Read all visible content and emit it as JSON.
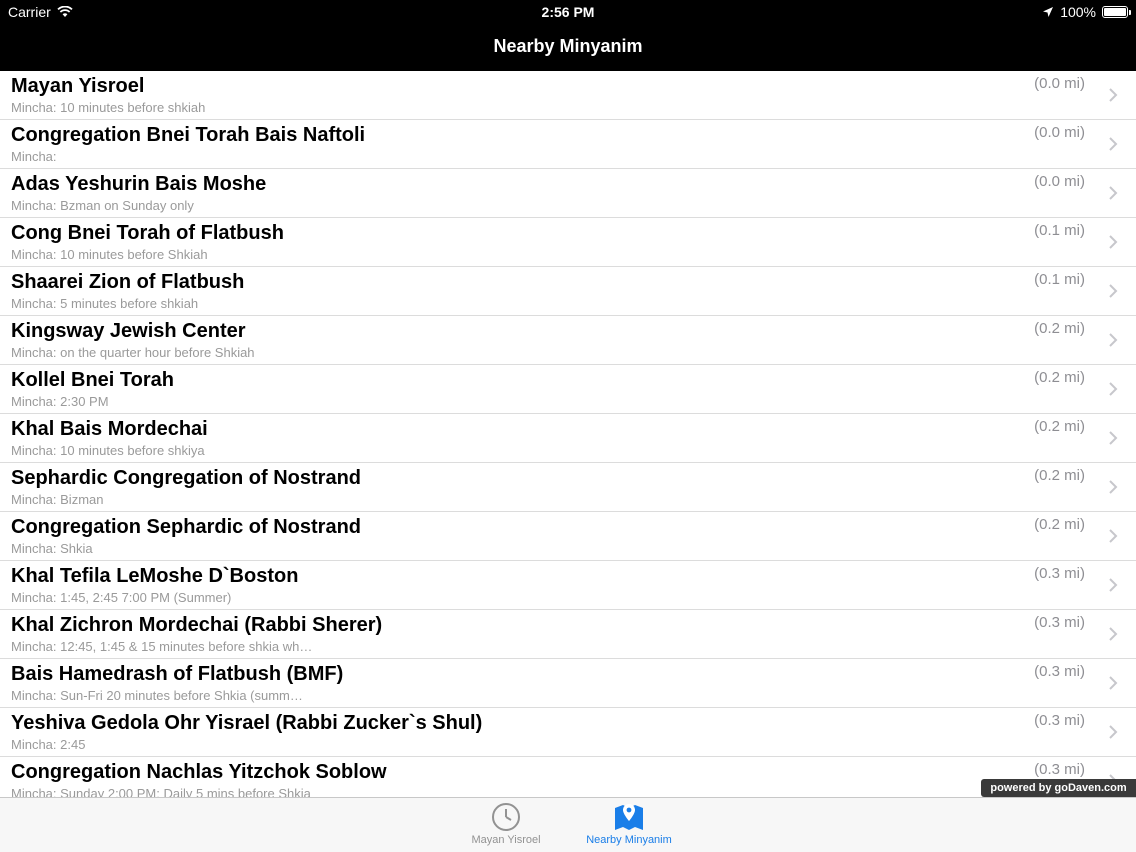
{
  "status_bar": {
    "carrier": "Carrier",
    "time": "2:56 PM",
    "battery": "100%"
  },
  "nav": {
    "title": "Nearby Minyanim"
  },
  "rows": [
    {
      "title": "Mayan Yisroel",
      "subtitle": "Mincha:  10 minutes before shkiah",
      "distance": "(0.0 mi)"
    },
    {
      "title": "Congregation Bnei Torah Bais Naftoli",
      "subtitle": "Mincha:",
      "distance": "(0.0 mi)"
    },
    {
      "title": "Adas Yeshurin Bais Moshe",
      "subtitle": "Mincha:  Bzman on Sunday only",
      "distance": "(0.0 mi)"
    },
    {
      "title": "Cong Bnei Torah of Flatbush",
      "subtitle": "Mincha:  10 minutes before Shkiah",
      "distance": "(0.1 mi)"
    },
    {
      "title": "Shaarei Zion of Flatbush",
      "subtitle": "Mincha:  5 minutes before shkiah",
      "distance": "(0.1 mi)"
    },
    {
      "title": "Kingsway Jewish Center",
      "subtitle": "Mincha:  on the quarter hour before Shkiah",
      "distance": "(0.2 mi)"
    },
    {
      "title": "Kollel Bnei Torah",
      "subtitle": "Mincha:  2:30 PM",
      "distance": "(0.2 mi)"
    },
    {
      "title": "Khal Bais Mordechai",
      "subtitle": "Mincha:  10 minutes before shkiya",
      "distance": "(0.2 mi)"
    },
    {
      "title": "Sephardic Congregation of Nostrand",
      "subtitle": "Mincha:  Bizman",
      "distance": "(0.2 mi)"
    },
    {
      "title": "Congregation Sephardic of Nostrand",
      "subtitle": "Mincha:  Shkia",
      "distance": "(0.2 mi)"
    },
    {
      "title": "Khal Tefila LeMoshe D`Boston",
      "subtitle": "Mincha: 1:45, 2:45 7:00 PM (Summer)",
      "distance": "(0.3 mi)"
    },
    {
      "title": "Khal Zichron Mordechai (Rabbi Sherer)",
      "subtitle": "Mincha: 12:45, 1:45 & 15 minutes before shkia wh…",
      "distance": "(0.3 mi)"
    },
    {
      "title": "Bais Hamedrash of Flatbush (BMF)",
      "subtitle": "Mincha:  Sun-Fri  20 minutes before Shkia (summ…",
      "distance": "(0.3 mi)"
    },
    {
      "title": "Yeshiva Gedola Ohr Yisrael (Rabbi Zucker`s Shul)",
      "subtitle": "Mincha: 2:45",
      "distance": "(0.3 mi)"
    },
    {
      "title": "Congregation Nachlas Yitzchok Soblow",
      "subtitle": "Mincha:  Sunday 2:00 PM; Daily 5 mins before Shkia",
      "distance": "(0.3 mi)"
    }
  ],
  "powered_by": "powered by goDaven.com",
  "tabs": [
    {
      "label": "Mayan Yisroel",
      "icon": "clock-icon"
    },
    {
      "label": "Nearby Minyanim",
      "icon": "map-pin-icon"
    }
  ],
  "colors": {
    "accent": "#1a7ee8",
    "bar": "#000000",
    "inactive": "#929292"
  }
}
